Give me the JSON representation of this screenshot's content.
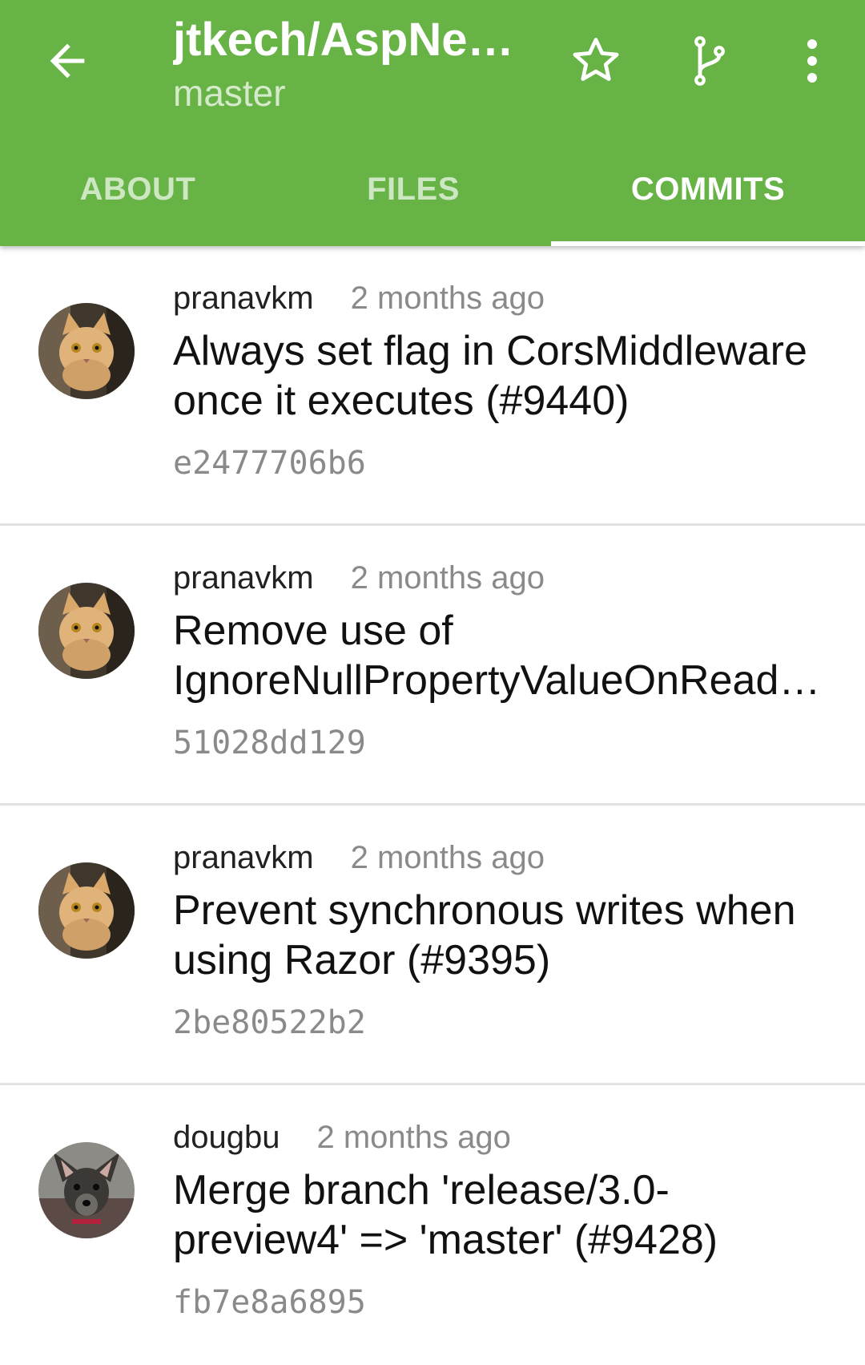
{
  "toolbar": {
    "title": "jtkech/AspNet…",
    "subtitle": "master",
    "back_icon": "arrow-left-icon",
    "actions": [
      "star-icon",
      "git-branch-icon",
      "more-vert-icon"
    ],
    "accent_color": "#67b346"
  },
  "tabs": [
    {
      "label": "ABOUT",
      "active": false
    },
    {
      "label": "FILES",
      "active": false
    },
    {
      "label": "COMMITS",
      "active": true
    }
  ],
  "commits": [
    {
      "author": "pranavkm",
      "time": "2 months ago",
      "message": "Always set flag in CorsMiddleware once it executes (#9440)",
      "sha": "e2477706b6",
      "avatar": "cat-avatar"
    },
    {
      "author": "pranavkm",
      "time": "2 months ago",
      "message": "Remove use of IgnoreNullPropertyVal­ueOnRead and ReaderOptions from JsonSerializer",
      "sha": "51028dd129",
      "avatar": "cat-avatar"
    },
    {
      "author": "pranavkm",
      "time": "2 months ago",
      "message": "Prevent synchronous writes when using Razor (#9395)",
      "sha": "2be80522b2",
      "avatar": "cat-avatar"
    },
    {
      "author": "dougbu",
      "time": "2 months ago",
      "message": "Merge branch 'release/3.0-preview4' => 'master' (#9428)",
      "sha": "fb7e8a6895",
      "avatar": "dog-avatar"
    }
  ]
}
